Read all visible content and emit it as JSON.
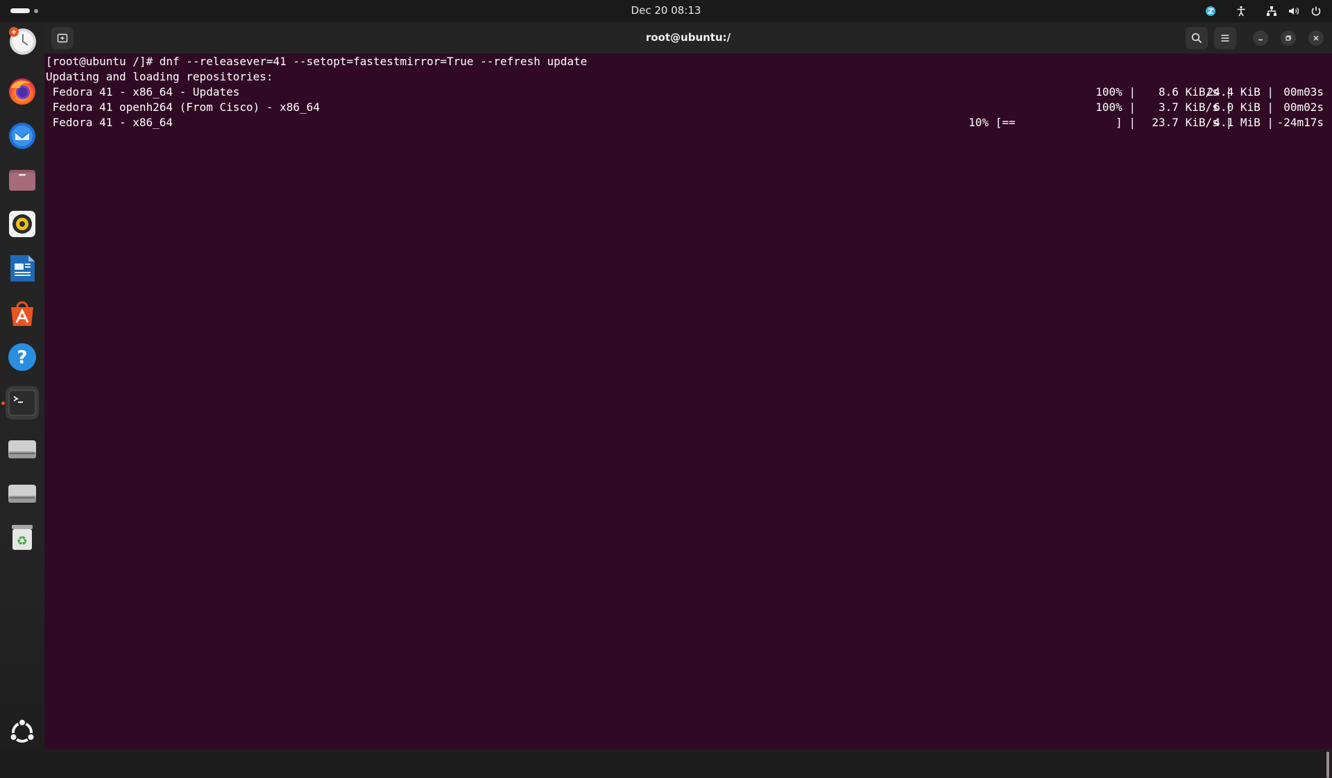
{
  "topbar": {
    "clock": "Dec 20  08:13"
  },
  "dock": {
    "items": [
      {
        "name": "software-updater-icon"
      },
      {
        "name": "firefox-icon"
      },
      {
        "name": "thunderbird-icon"
      },
      {
        "name": "files-icon"
      },
      {
        "name": "rhythmbox-icon"
      },
      {
        "name": "libreoffice-writer-icon"
      },
      {
        "name": "app-center-icon"
      },
      {
        "name": "help-icon"
      },
      {
        "name": "terminal-icon"
      },
      {
        "name": "drive-icon"
      },
      {
        "name": "drive-icon"
      },
      {
        "name": "trash-icon"
      }
    ],
    "show_apps": "ubuntu-logo-icon"
  },
  "window": {
    "title": "root@ubuntu:/"
  },
  "terminal": {
    "command_line": "[root@ubuntu /]# dnf --releasever=41 --setopt=fastestmirror=True --refresh update",
    "status_line": "Updating and loading repositories:",
    "repos": [
      {
        "name": " Fedora 41 - x86_64 - Updates",
        "progress": "100% |",
        "speed": "  8.6 KiB/s |",
        "size": " 24.4 KiB |",
        "time": "  00m03s"
      },
      {
        "name": " Fedora 41 openh264 (From Cisco) - x86_64",
        "progress": "100% |",
        "speed": "  3.7 KiB/s |",
        "size": "  6.0 KiB |",
        "time": "  00m02s"
      },
      {
        "name": " Fedora 41 - x86_64",
        "progress": "10% [==               ] |",
        "speed": " 23.7 KiB/s |",
        "size": "  4.1 MiB |",
        "time": " -24m17s"
      }
    ]
  },
  "colors": {
    "terminal_bg": "#300a24",
    "accent": "#e95420"
  }
}
